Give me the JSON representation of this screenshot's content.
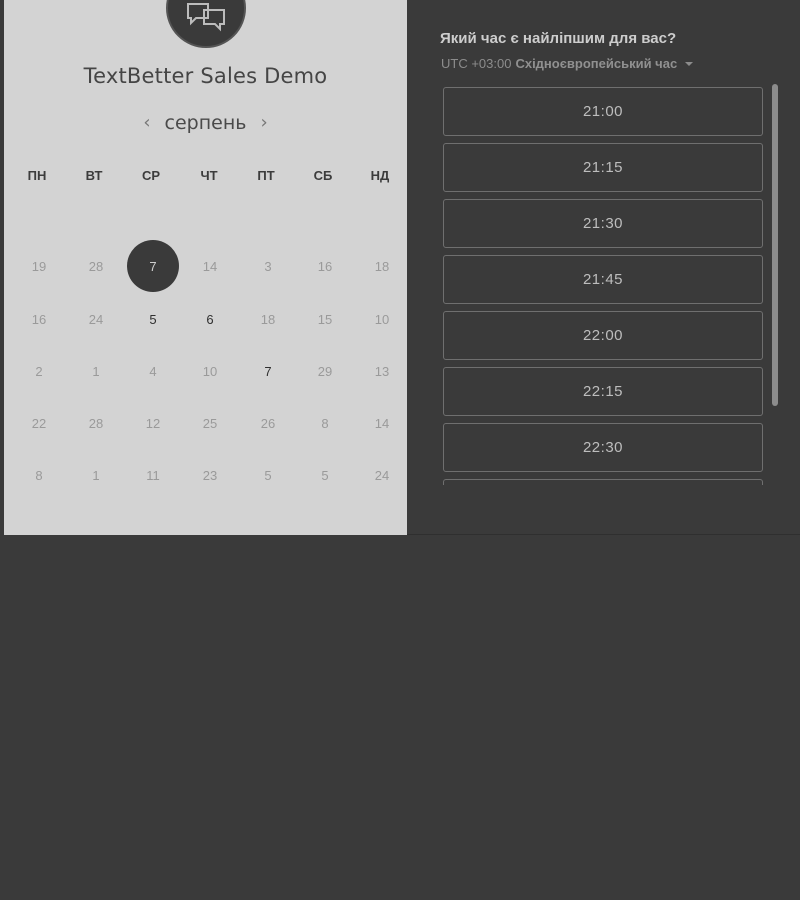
{
  "calendar": {
    "title": "TextBetter Sales Demo",
    "month": "серпень",
    "weekdays": [
      "ПН",
      "ВТ",
      "СР",
      "ЧТ",
      "ПТ",
      "СБ",
      "НД"
    ],
    "rows": [
      [
        "19",
        "28",
        "7",
        "14",
        "3",
        "16",
        "18"
      ],
      [
        "16",
        "24",
        "5",
        "6",
        "18",
        "15",
        "10"
      ],
      [
        "2",
        "1",
        "4",
        "10",
        "7",
        "29",
        "13"
      ],
      [
        "22",
        "28",
        "12",
        "25",
        "26",
        "8",
        "14"
      ],
      [
        "8",
        "1",
        "11",
        "23",
        "5",
        "5",
        "24"
      ]
    ],
    "selected_day": "7",
    "available_days": [
      "5",
      "6",
      "7"
    ]
  },
  "scheduler": {
    "question": "Який час є найліпшим для вас?",
    "timezone_offset": "UTC +03:00",
    "timezone_name": "Східноєвропейський час",
    "slots": [
      "21:00",
      "21:15",
      "21:30",
      "21:45",
      "22:00",
      "22:15",
      "22:30",
      ""
    ]
  },
  "icons": {
    "avatar": "chat-bubbles-icon",
    "prev": "chevron-left-icon",
    "next": "chevron-right-icon",
    "timezone": "caret-down-icon"
  },
  "colors": {
    "panel_bg": "#d3d3d3",
    "dark_bg": "#3a3a3a",
    "selected_day_bg": "#3a3a3a",
    "slot_border": "#6f6f6f"
  }
}
